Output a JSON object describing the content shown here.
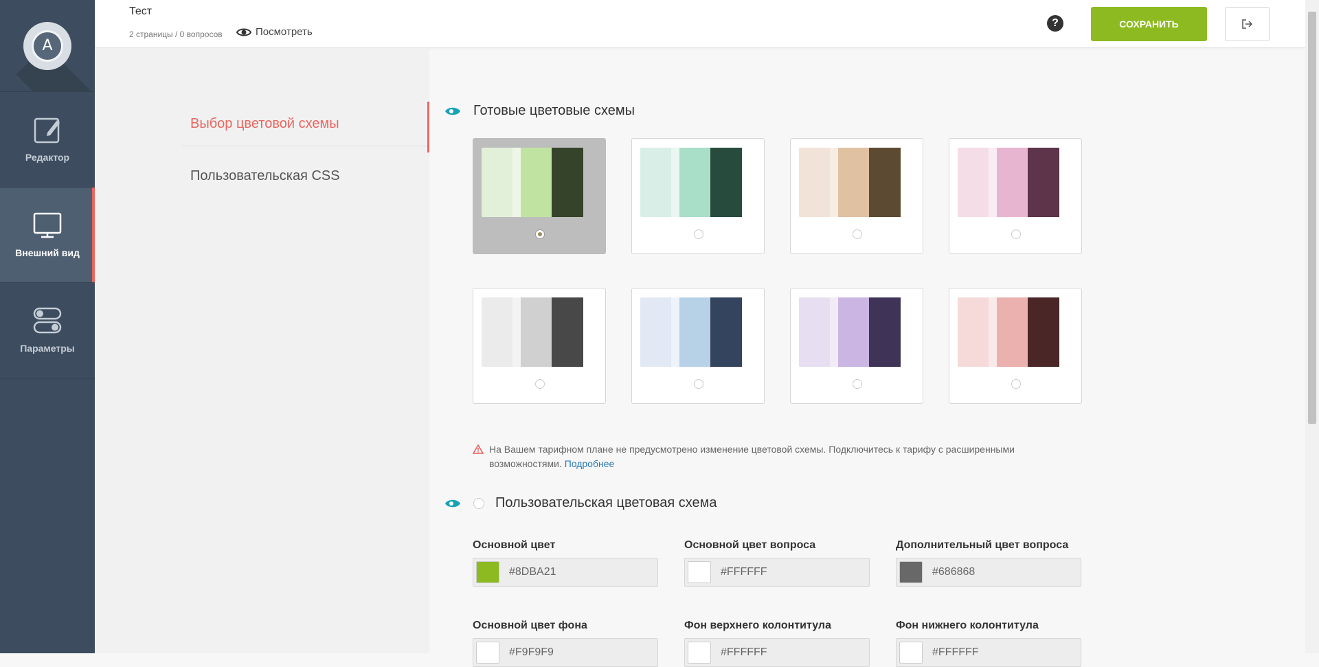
{
  "sidebar": {
    "logo_letter": "A",
    "items": [
      {
        "label": "Редактор",
        "icon": "edit-icon"
      },
      {
        "label": "Внешний вид",
        "icon": "monitor-icon"
      },
      {
        "label": "Параметры",
        "icon": "toggles-icon"
      }
    ]
  },
  "header": {
    "title": "Тест",
    "subtitle": "2 страницы / 0 вопросов",
    "preview_label": "Посмотреть",
    "help_label": "?",
    "save_label": "СОХРАНИТЬ"
  },
  "subnav": {
    "items": [
      "Выбор цветовой схемы",
      "Пользовательская CSS"
    ]
  },
  "presets": {
    "title": "Готовые цветовые схемы",
    "schemes": [
      {
        "colors": [
          "#e2f0d9",
          "#eef6e8",
          "#c0e3a2",
          "#35432a"
        ],
        "selected": true
      },
      {
        "colors": [
          "#d9eee6",
          "#ebf6f2",
          "#a9dec8",
          "#274c3d"
        ],
        "selected": false
      },
      {
        "colors": [
          "#f2e3d8",
          "#f7ede5",
          "#e0c2a3",
          "#5c4a33"
        ],
        "selected": false
      },
      {
        "colors": [
          "#f4dde7",
          "#f9ecf2",
          "#e8b5d1",
          "#5d3449"
        ],
        "selected": false
      },
      {
        "colors": [
          "#ebebeb",
          "#f3f3f3",
          "#d0d0d0",
          "#484848"
        ],
        "selected": false
      },
      {
        "colors": [
          "#e2e9f5",
          "#eef2fa",
          "#b7d1e6",
          "#34435e"
        ],
        "selected": false
      },
      {
        "colors": [
          "#e8def2",
          "#f1ebf8",
          "#cab5e3",
          "#3f3358"
        ],
        "selected": false
      },
      {
        "colors": [
          "#f6dada",
          "#fae9e9",
          "#eab1ae",
          "#4a2626"
        ],
        "selected": false
      }
    ]
  },
  "warning": {
    "text": "На Вашем тарифном плане не предусмотрено изменение цветовой схемы. Подключитесь к тарифу с расширенными возможностями.",
    "link": "Подробнее"
  },
  "custom": {
    "title": "Пользовательская цветовая схема",
    "fields": [
      {
        "label": "Основной цвет",
        "value": "#8DBA21",
        "chip": "#8dba21"
      },
      {
        "label": "Основной цвет вопроса",
        "value": "#FFFFFF",
        "chip": "#ffffff"
      },
      {
        "label": "Дополнительный цвет вопроса",
        "value": "#686868",
        "chip": "#686868"
      },
      {
        "label": "Основной цвет фона",
        "value": "#F9F9F9",
        "chip": "#ffffff"
      },
      {
        "label": "Фон верхнего колонтитула",
        "value": "#FFFFFF",
        "chip": "#ffffff"
      },
      {
        "label": "Фон нижнего колонтитула",
        "value": "#FFFFFF",
        "chip": "#ffffff"
      }
    ]
  },
  "colors": {
    "accent": "#e8665f",
    "save": "#8dba21",
    "sidebar": "#3d4c5e",
    "link": "#2a7ab5",
    "eye": "#17a2b8"
  }
}
